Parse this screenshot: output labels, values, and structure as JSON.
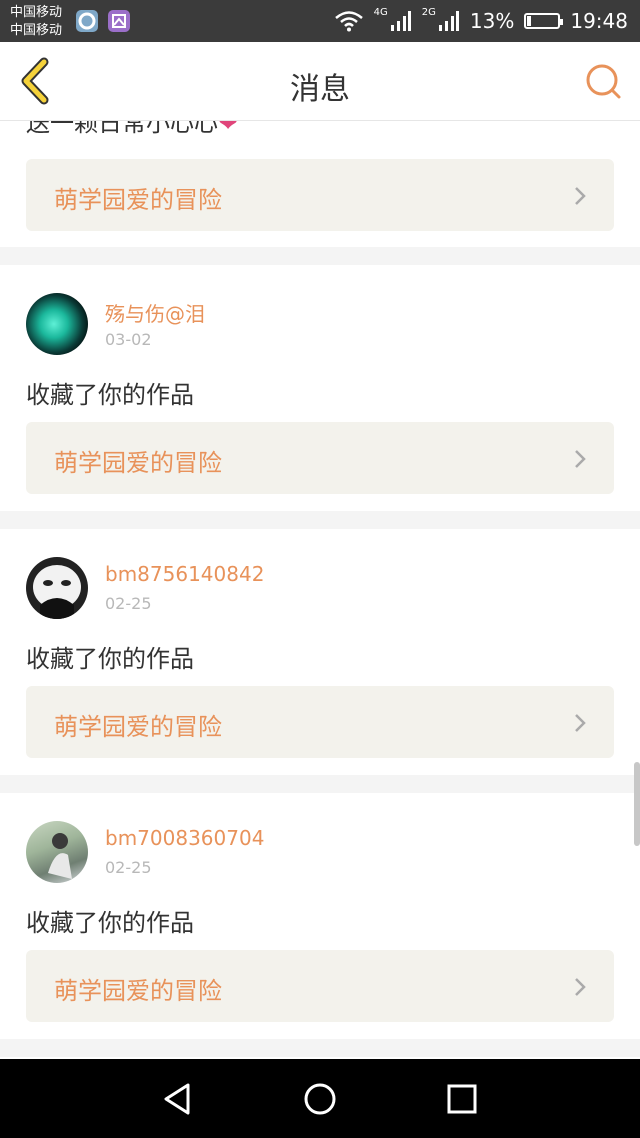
{
  "status_bar": {
    "carrier_1": "中国移动",
    "carrier_2": "中国移动",
    "net_1": "4G",
    "net_2": "2G",
    "battery_text": "13%",
    "battery_level": 0.13,
    "time": "19:48"
  },
  "nav": {
    "title": "消息",
    "back_icon": "chevron-left-icon",
    "search_icon": "search-icon",
    "accent": "#e8925a"
  },
  "top_partial": {
    "text": "送一颗日常小心心",
    "emoji": "❤",
    "work_title": "萌学园爱的冒险"
  },
  "messages": [
    {
      "username": "殇与伤@泪",
      "date": "03-02",
      "action": "收藏了你的作品",
      "work_title": "萌学园爱的冒险"
    },
    {
      "username": "bm8756140842",
      "date": "02-25",
      "action": "收藏了你的作品",
      "work_title": "萌学园爱的冒险"
    },
    {
      "username": "bm7008360704",
      "date": "02-25",
      "action": "收藏了你的作品",
      "work_title": "萌学园爱的冒险"
    }
  ],
  "system_nav": {
    "back": "back-triangle-icon",
    "home": "home-circle-icon",
    "recents": "recents-square-icon"
  }
}
